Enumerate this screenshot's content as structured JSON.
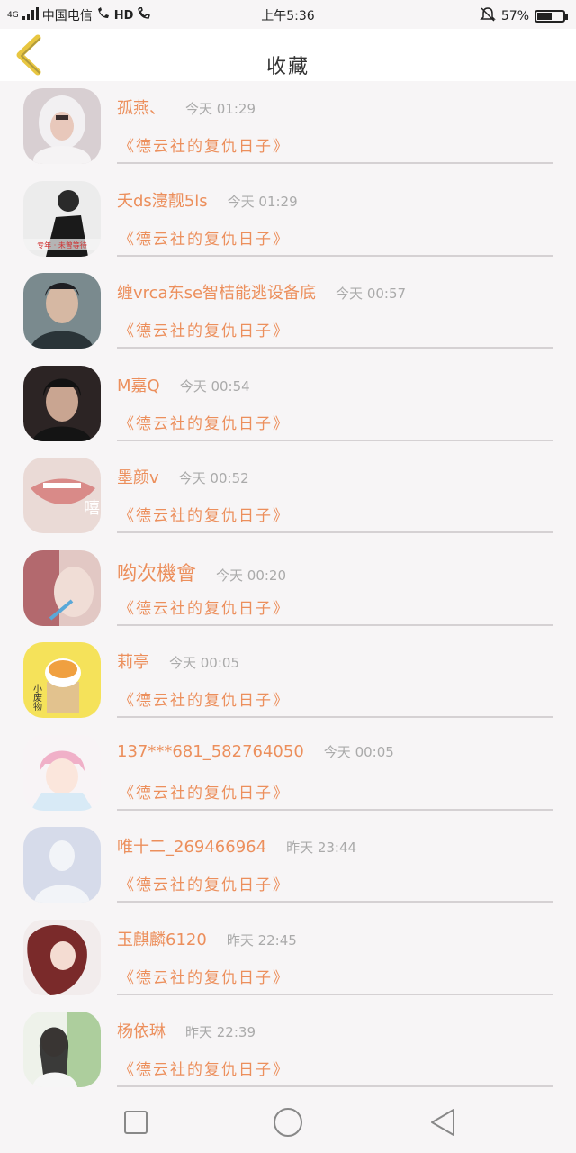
{
  "status_bar": {
    "network": "4G",
    "carrier": "中国电信",
    "hd": "HD",
    "time": "上午5:36",
    "battery": "57%",
    "battery_level": 0.57
  },
  "header": {
    "title": "收藏"
  },
  "items": [
    {
      "username": "孤燕、",
      "time": "今天 01:29",
      "work": "《德云社的复仇日子》",
      "avatar": "girl-white-hood-photo"
    },
    {
      "username": "夭ds濅靓5ls",
      "time": "今天 01:29",
      "work": "《德云社的复仇日子》",
      "avatar": "girl-back-text-photo",
      "avatar_text": "专年 · 未曾等待"
    },
    {
      "username": "缠vrca东se智桔能逃设备底",
      "time": "今天 00:57",
      "work": "《德云社的复仇日子》",
      "avatar": "man-dark-photo"
    },
    {
      "username": "M嘉Q",
      "time": "今天 00:54",
      "work": "《德云社的复仇日子》",
      "avatar": "boy-dark-photo"
    },
    {
      "username": "墨颜v",
      "time": "今天 00:52",
      "work": "《德云社的复仇日子》",
      "avatar": "lips-photo",
      "avatar_text": "嘻"
    },
    {
      "username": "哟次機會",
      "time": "今天 00:20",
      "work": "《德云社的复仇日子》",
      "avatar": "girl-blurred-photo"
    },
    {
      "username": "莉亭",
      "time": "今天 00:05",
      "work": "《德云社的复仇日子》",
      "avatar": "cartoon-cat",
      "avatar_text": "小废物"
    },
    {
      "username": "137***681_582764050",
      "time": "今天 00:05",
      "work": "《德云社的复仇日子》",
      "avatar": "anime-boy-pink"
    },
    {
      "username": "唯十二_269466964",
      "time": "昨天 23:44",
      "work": "《德云社的复仇日子》",
      "avatar": "default-person"
    },
    {
      "username": "玉麒麟6120",
      "time": "昨天 22:45",
      "work": "《德云社的复仇日子》",
      "avatar": "anime-couple-illustration"
    },
    {
      "username": "杨依琳",
      "time": "昨天 22:39",
      "work": "《德云社的复仇日子》",
      "avatar": "girl-plants-photo"
    }
  ],
  "colors": {
    "accent": "#ec8f5c",
    "back_arrow": "#e8c640",
    "timestamp": "#aaaaaa",
    "divider": "#d5d1d3"
  }
}
